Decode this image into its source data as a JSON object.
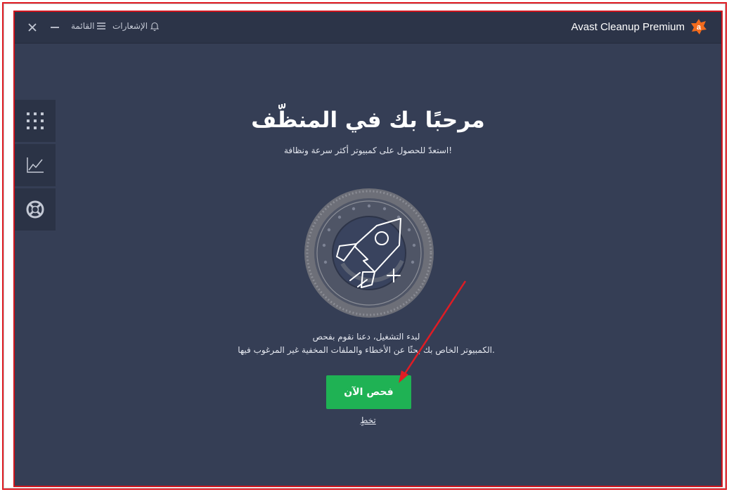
{
  "window": {
    "title": "Avast Cleanup Premium",
    "menu_label": "القائمة",
    "notifications_label": "الإشعارات"
  },
  "main": {
    "heading": "مرحبًا بك في المنظّف",
    "subheading": "استعدّ للحصول على كمبيوتر أكثر سرعة ونظافة!",
    "desc_line1": "لبدء التشغيل، دعنا نقوم بفحص",
    "desc_line2": "الكمبيوتر الخاص بك بحثًا عن الأخطاء والملفات المخفية غير المرغوب فيها.",
    "scan_button": "فحص الآن",
    "skip_link": "تخطٍ"
  },
  "sidebar": {
    "items": [
      {
        "icon": "grid-icon"
      },
      {
        "icon": "chart-icon"
      },
      {
        "icon": "lifebuoy-icon"
      }
    ]
  },
  "colors": {
    "window_bg": "#353e55",
    "titlebar_bg": "#2c3448",
    "accent_green": "#1fb254",
    "brand_orange": "#f26b1d",
    "annotation_red": "#e01c24"
  }
}
